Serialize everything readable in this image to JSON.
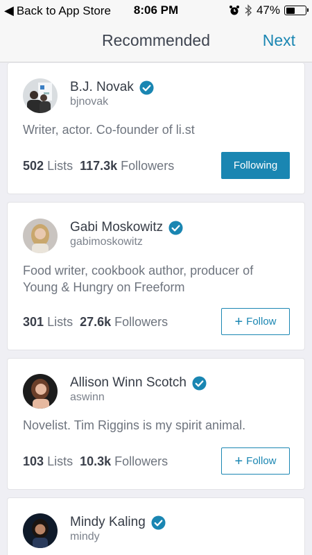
{
  "status_bar": {
    "back_label": "Back to App Store",
    "time": "8:06 PM",
    "battery": "47%",
    "battery_level": 0.47
  },
  "nav": {
    "title": "Recommended",
    "next_label": "Next"
  },
  "colors": {
    "accent": "#1a86b2",
    "background": "#efeff4"
  },
  "users": [
    {
      "name": "B.J. Novak",
      "handle": "bjnovak",
      "bio": "Writer, actor. Co-founder of li.st",
      "lists_count": "502",
      "lists_label": "Lists",
      "followers_count": "117.3k",
      "followers_label": "Followers",
      "button_label": "Following",
      "following": true
    },
    {
      "name": "Gabi Moskowitz",
      "handle": "gabimoskowitz",
      "bio": "Food writer, cookbook author, producer of Young & Hungry on Freeform",
      "lists_count": "301",
      "lists_label": "Lists",
      "followers_count": "27.6k",
      "followers_label": "Followers",
      "button_label": "Follow",
      "following": false
    },
    {
      "name": "Allison Winn Scotch",
      "handle": "aswinn",
      "bio": "Novelist. Tim Riggins is my spirit animal.",
      "lists_count": "103",
      "lists_label": "Lists",
      "followers_count": "10.3k",
      "followers_label": "Followers",
      "button_label": "Follow",
      "following": false
    },
    {
      "name": "Mindy Kaling",
      "handle": "mindy"
    }
  ]
}
